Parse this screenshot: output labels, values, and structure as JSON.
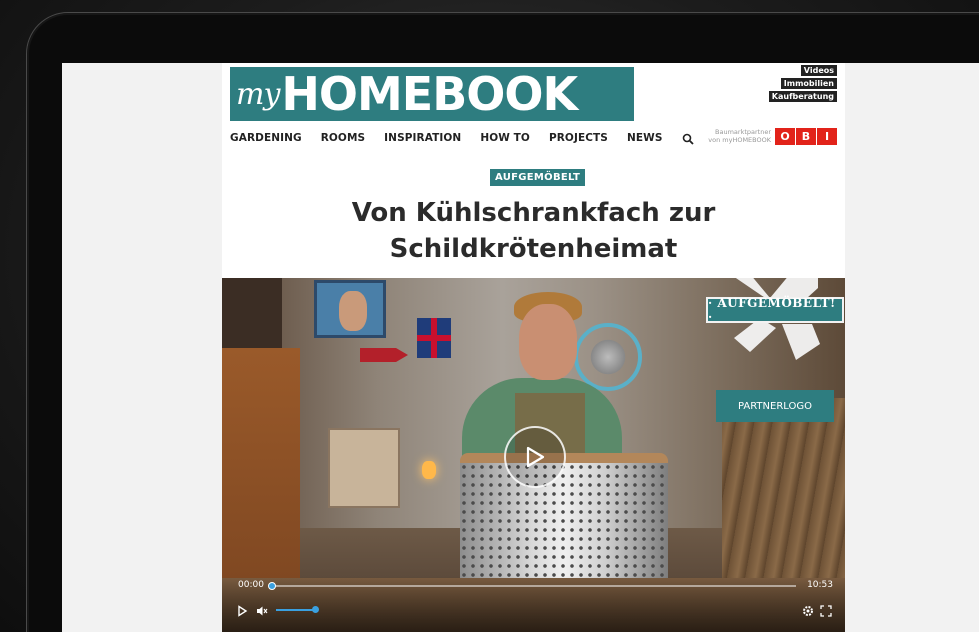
{
  "site": {
    "logo_prefix": "my",
    "logo_main": "HOMEBOOK",
    "quick_links": [
      "Videos",
      "Immobilien",
      "Kaufberatung"
    ]
  },
  "nav": {
    "items": [
      "GARDENING",
      "ROOMS",
      "INSPIRATION",
      "HOW TO",
      "PROJECTS",
      "NEWS"
    ],
    "search_icon": "search-icon"
  },
  "partner": {
    "line1": "Baumarktpartner",
    "line2": "von myHOMEBOOK",
    "brand": "OBI"
  },
  "article": {
    "category": "AUFGEMÖBELT",
    "title_line1": "Von Kühlschrankfach zur",
    "title_line2": "Schildkrötenheimat"
  },
  "video": {
    "badge": "· AUFGEMÖBELT! ·",
    "partner_logo": "PARTNERLOGO",
    "current_time": "00:00",
    "duration": "10:53",
    "progress_fraction": 0.0,
    "volume_fraction": 1.0
  },
  "colors": {
    "accent": "#2e7d80",
    "obi_red": "#e2231a",
    "player_blue": "#3aa0e0"
  }
}
